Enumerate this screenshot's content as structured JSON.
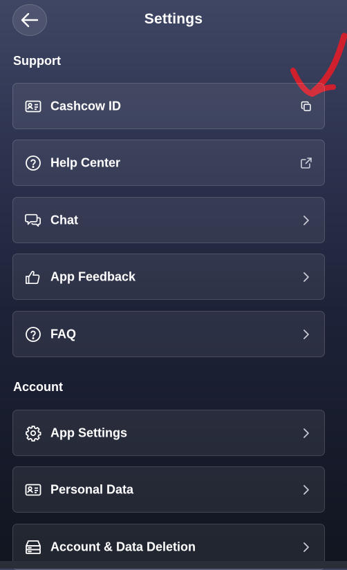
{
  "header": {
    "title": "Settings",
    "back_icon": "arrow-left-icon"
  },
  "sections": [
    {
      "title": "Support",
      "items": [
        {
          "label": "Cashcow ID",
          "icon": "id-card-icon",
          "trailing_icon": "copy-icon"
        },
        {
          "label": "Help Center",
          "icon": "question-circle-icon",
          "trailing_icon": "external-link-icon"
        },
        {
          "label": "Chat",
          "icon": "chat-bubbles-icon",
          "trailing_icon": "chevron-right-icon"
        },
        {
          "label": "App Feedback",
          "icon": "thumbs-up-icon",
          "trailing_icon": "chevron-right-icon"
        },
        {
          "label": "FAQ",
          "icon": "question-circle-icon",
          "trailing_icon": "chevron-right-icon"
        }
      ]
    },
    {
      "title": "Account",
      "items": [
        {
          "label": "App Settings",
          "icon": "gear-icon",
          "trailing_icon": "chevron-right-icon"
        },
        {
          "label": "Personal Data",
          "icon": "id-card-icon",
          "trailing_icon": "chevron-right-icon"
        },
        {
          "label": "Account & Data Deletion",
          "icon": "storage-icon",
          "trailing_icon": "chevron-right-icon"
        }
      ]
    }
  ],
  "colors": {
    "background_top": "#3f4663",
    "background_bottom": "#11151f",
    "annotation_arrow": "#d0202e"
  }
}
